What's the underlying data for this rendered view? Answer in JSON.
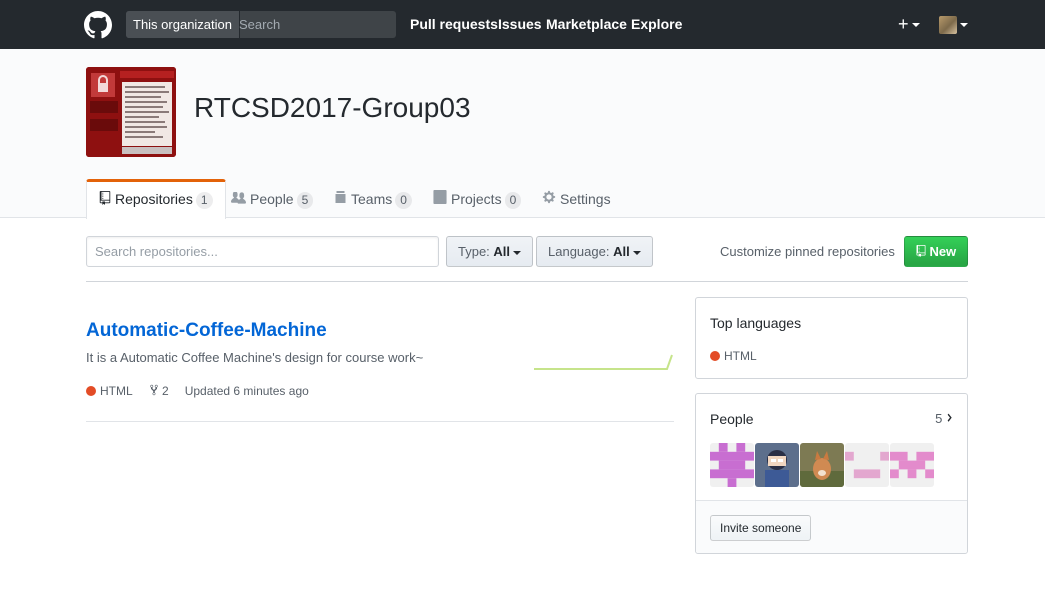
{
  "header": {
    "scope_label": "This organization",
    "search_placeholder": "Search",
    "nav": [
      "Pull requests",
      "Issues",
      "Marketplace",
      "Explore"
    ],
    "plus_label": "+"
  },
  "org": {
    "name": "RTCSD2017-Group03",
    "tabs": [
      {
        "label": "Repositories",
        "count": "1",
        "icon": "repo-icon",
        "selected": true
      },
      {
        "label": "People",
        "count": "5",
        "icon": "people-icon"
      },
      {
        "label": "Teams",
        "count": "0",
        "icon": "teams-icon"
      },
      {
        "label": "Projects",
        "count": "0",
        "icon": "project-icon"
      },
      {
        "label": "Settings",
        "icon": "gear-icon"
      }
    ]
  },
  "filters": {
    "search_placeholder": "Search repositories...",
    "type_label": "Type:",
    "type_value": "All",
    "language_label": "Language:",
    "language_value": "All",
    "customize_label": "Customize pinned repositories",
    "new_label": "New"
  },
  "repos": [
    {
      "name": "Automatic-Coffee-Machine",
      "description": "It is a Automatic Coffee Machine's design for course work~",
      "language": "HTML",
      "language_color": "#e34c26",
      "forks": "2",
      "updated": "Updated 6 minutes ago"
    }
  ],
  "sidebar": {
    "top_languages_title": "Top languages",
    "top_languages": [
      {
        "name": "HTML",
        "color": "#e34c26"
      }
    ],
    "people_title": "People",
    "people_count": "5",
    "invite_label": "Invite someone"
  },
  "colors": {
    "header_bg": "#24292e",
    "accent_tab": "#e36209",
    "link": "#0366d6",
    "new_button": "#28a745"
  }
}
